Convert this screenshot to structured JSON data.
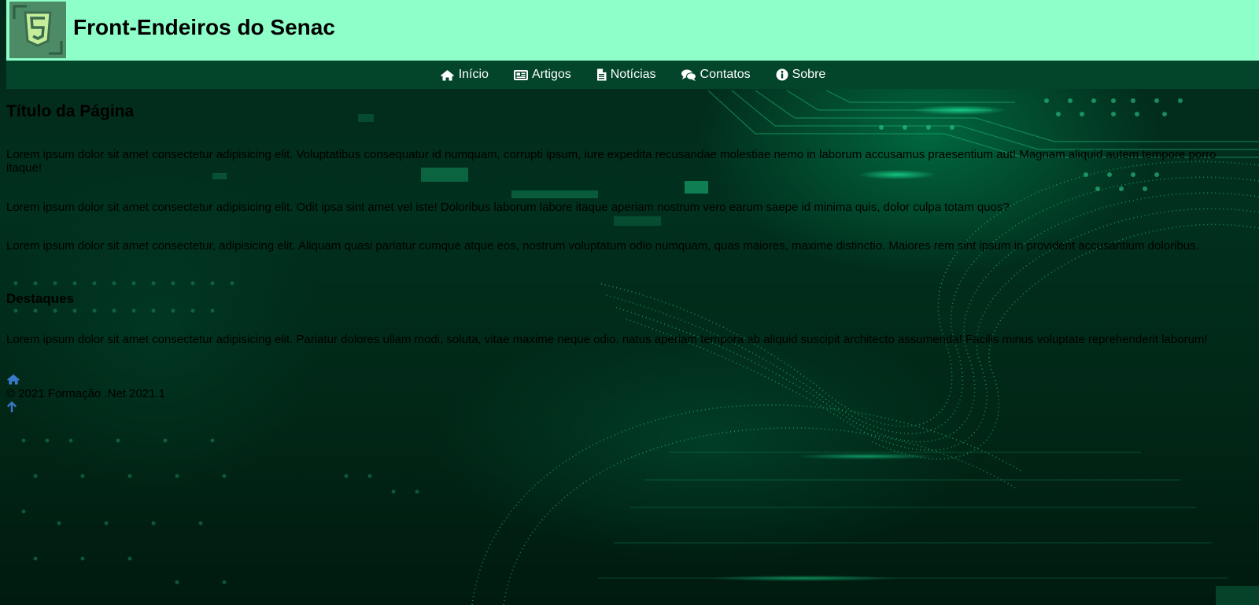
{
  "header": {
    "title": "Front-Endeiros do Senac",
    "logo_icon": "html5-logo-icon"
  },
  "nav": {
    "items": [
      {
        "label": "Início",
        "icon": "home-icon"
      },
      {
        "label": "Artigos",
        "icon": "newspaper-icon"
      },
      {
        "label": "Notícias",
        "icon": "file-text-icon"
      },
      {
        "label": "Contatos",
        "icon": "comments-icon"
      },
      {
        "label": "Sobre",
        "icon": "info-circle-icon"
      }
    ]
  },
  "main": {
    "title": "Título da Página",
    "paragraphs": [
      "Lorem ipsum dolor sit amet consectetur adipisicing elit. Voluptatibus consequatur id numquam, corrupti ipsum, iure expedita recusandae molestiae nemo in laborum accusamus praesentium aut! Magnam aliquid autem tempore porro itaque!",
      "Lorem ipsum dolor sit amet consectetur adipisicing elit. Odit ipsa sint amet vel iste! Doloribus laborum labore itaque aperiam nostrum vero earum saepe id minima quis, dolor culpa totam quos?",
      "Lorem ipsum dolor sit amet consectetur, adipisicing elit. Aliquam quasi pariatur cumque atque eos, nostrum voluptatum odio numquam, quas maiores, maxime distinctio. Maiores rem sint ipsum in provident accusantium doloribus."
    ],
    "highlights_title": "Destaques",
    "highlights_paragraph": "Lorem ipsum dolor sit amet consectetur adipisicing elit. Pariatur dolores ullam modi, soluta, vitae maxime neque odio, natus aperiam tempora ab aliquid suscipit architecto assumenda! Facilis minus voluptate reprehenderit laborum!"
  },
  "footer": {
    "home_icon": "home-icon",
    "copyright": "© 2021 Formação .Net 2021.1",
    "back_to_top_icon": "arrow-up-icon"
  },
  "colors": {
    "header_bg": "#8effc8",
    "nav_bg": "#02452a",
    "link_icon": "#3b79c9",
    "page_bg": "#012616"
  }
}
